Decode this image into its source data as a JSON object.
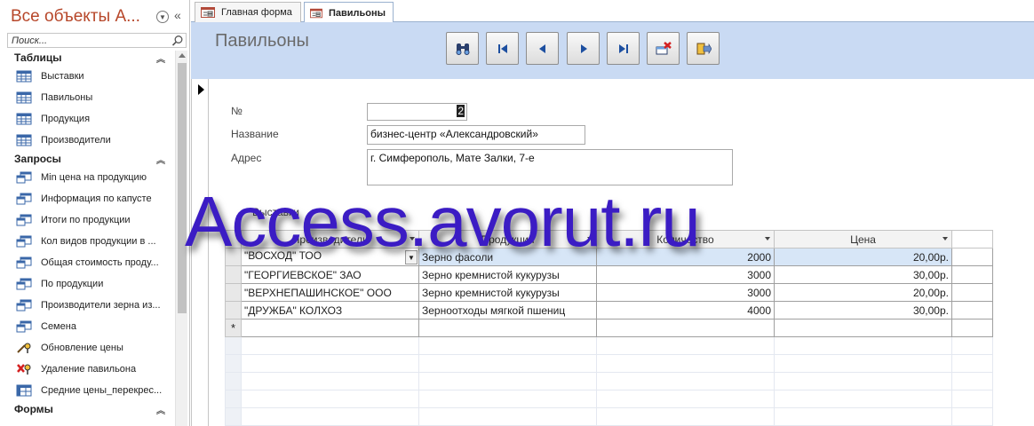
{
  "navigation": {
    "title": "Все объекты A...",
    "search_placeholder": "Поиск...",
    "groups": [
      {
        "label": "Таблицы",
        "items": [
          {
            "label": "Выставки",
            "icon": "table-icon"
          },
          {
            "label": "Павильоны",
            "icon": "table-icon"
          },
          {
            "label": "Продукция",
            "icon": "table-icon"
          },
          {
            "label": "Производители",
            "icon": "table-icon"
          }
        ]
      },
      {
        "label": "Запросы",
        "items": [
          {
            "label": "Min цена на продукцию",
            "icon": "query-icon"
          },
          {
            "label": "Информация по капусте",
            "icon": "query-icon"
          },
          {
            "label": "Итоги по продукции",
            "icon": "query-icon"
          },
          {
            "label": "Кол видов продукции в ...",
            "icon": "query-icon"
          },
          {
            "label": "Общая стоимость проду...",
            "icon": "query-icon"
          },
          {
            "label": "По продукции",
            "icon": "query-icon"
          },
          {
            "label": "Производители зерна из...",
            "icon": "query-icon"
          },
          {
            "label": "Семена",
            "icon": "query-icon"
          },
          {
            "label": "Обновление цены",
            "icon": "update-query-icon"
          },
          {
            "label": "Удаление павильона",
            "icon": "delete-query-icon"
          },
          {
            "label": "Средние цены_перекрес...",
            "icon": "crosstab-query-icon"
          }
        ]
      },
      {
        "label": "Формы",
        "items": []
      }
    ]
  },
  "tabs": [
    {
      "label": "Главная форма",
      "active": false
    },
    {
      "label": "Павильоны",
      "active": true
    }
  ],
  "form": {
    "title": "Павильоны",
    "nav_buttons": [
      "find-icon",
      "first-record-icon",
      "previous-record-icon",
      "next-record-icon",
      "last-record-icon",
      "delete-record-icon",
      "close-form-icon"
    ],
    "fields": {
      "number_label": "№",
      "number_value": "2",
      "name_label": "Название",
      "name_value": "бизнес-центр «Александровский»",
      "address_label": "Адрес",
      "address_value": "г. Симферополь, Мате Залки, 7-е"
    },
    "subform": {
      "label": "Выставки",
      "columns": [
        "Производитель",
        "Продукция",
        "Количество",
        "Цена"
      ],
      "rows": [
        {
          "producer": "\"ВОСХОД\" ТОО",
          "product": "Зерно фасоли",
          "quantity": "2000",
          "price": "20,00р."
        },
        {
          "producer": "\"ГЕОРГИЕВСКОЕ\" ЗАО",
          "product": "Зерно кремнистой кукурузы",
          "quantity": "3000",
          "price": "30,00р."
        },
        {
          "producer": "\"ВЕРХНЕПАШИНСКОЕ\" ООО",
          "product": "Зерно кремнистой кукурузы",
          "quantity": "3000",
          "price": "20,00р."
        },
        {
          "producer": "\"ДРУЖБА\" КОЛХОЗ",
          "product": "Зерноотходы мягкой пшениц",
          "quantity": "4000",
          "price": "30,00р."
        }
      ],
      "new_row_marker": "*"
    }
  },
  "watermark": "Access.avorut.ru",
  "colors": {
    "nav_title": "#b7472a",
    "form_header": "#c9daf3",
    "watermark": "#3b1cc4"
  }
}
